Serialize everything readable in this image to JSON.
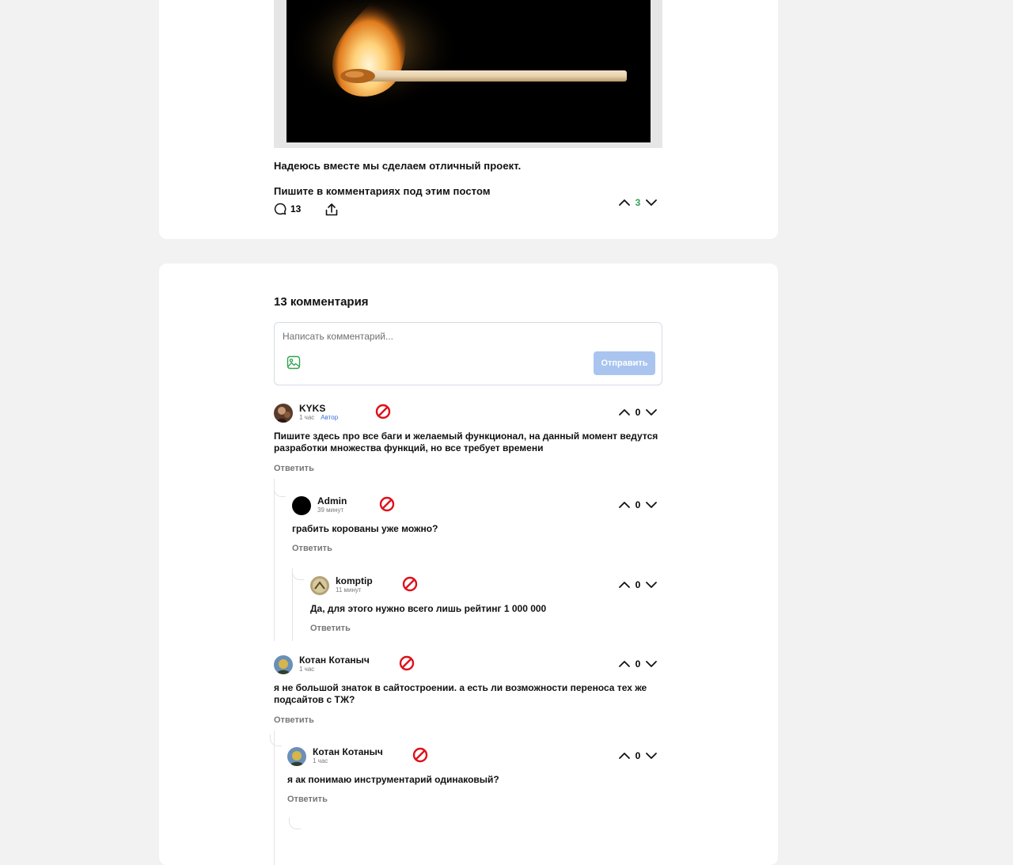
{
  "post": {
    "line1": "Надеюсь вместе мы сделаем отличный проект.",
    "line2": "Пишите в комментариях под этим постом",
    "comments_count": "13",
    "rating": "3",
    "image_alt": "Горящая спичка"
  },
  "comments_section": {
    "title": "13 комментария",
    "placeholder": "Написать комментарий...",
    "send_label": "Отправить"
  },
  "comments": [
    {
      "author": "KYKS",
      "time": "1 час",
      "badge": "Автор",
      "text": "Пишите здесь про все баги и желаемый функционал, на данный момент ведутся разработки множества функций, но все требует времени",
      "votes": "0",
      "reply": "Ответить"
    },
    {
      "author": "Admin",
      "time": "39 минут",
      "text": "грабить корованы уже можно?",
      "votes": "0",
      "reply": "Ответить"
    },
    {
      "author": "komptip",
      "time": "11 минут",
      "text": "Да, для этого нужно всего лишь рейтинг 1 000 000",
      "votes": "0",
      "reply": "Ответить"
    },
    {
      "author": "Котан Котаныч",
      "time": "1 час",
      "text": "я не большой знаток в сайтостроении. а есть ли возможности переноса тех же подсайтов с ТЖ?",
      "votes": "0",
      "reply": "Ответить"
    },
    {
      "author": "Котан Котаныч",
      "time": "1 час",
      "text": "я  ак понимаю инструментарий одинаковый?",
      "votes": "0",
      "reply": "Ответить"
    }
  ],
  "colors": {
    "page_bg": "#f2f2f2",
    "card_bg": "#ffffff",
    "positive_rating": "#2ea44f",
    "send_button": "#a9c4ef",
    "author_badge": "#3b6fd4",
    "ban_icon": "#e0101a"
  },
  "icons": {
    "comments": "speech-bubble-icon",
    "share": "share-icon",
    "upvote": "chevron-up-icon",
    "downvote": "chevron-down-icon",
    "ban": "ban-icon",
    "attach_image": "image-icon"
  }
}
